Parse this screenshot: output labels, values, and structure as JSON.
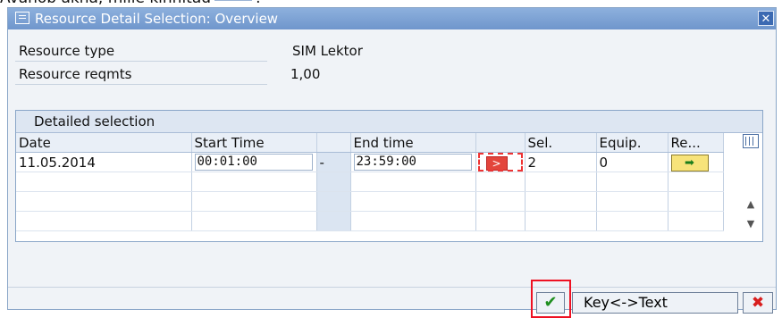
{
  "top_caption": "Avanob akna, mille kinnitad",
  "title": "Resource Detail Selection: Overview",
  "fields": [
    {
      "label": "Resource type",
      "value": "SIM Lektor"
    },
    {
      "label": "Resource reqmts",
      "value": "1,00"
    }
  ],
  "table": {
    "title": "Detailed selection",
    "columns": [
      "Date",
      "Start Time",
      "",
      "End time",
      "",
      "Sel.",
      "Equip.",
      "Re..."
    ],
    "rows": [
      {
        "date": "11.05.2014",
        "start": "00:01:00",
        "dash": "-",
        "end": "23:59:00",
        "sel": "2",
        "equip": "0"
      }
    ]
  },
  "buttons": {
    "key_text": "Key<->Text"
  },
  "icons": {
    "arrow": "arrow-right-icon",
    "confirm": "checkmark-icon",
    "cancel": "cancel-x-icon",
    "column_settings": "table-settings-icon"
  }
}
